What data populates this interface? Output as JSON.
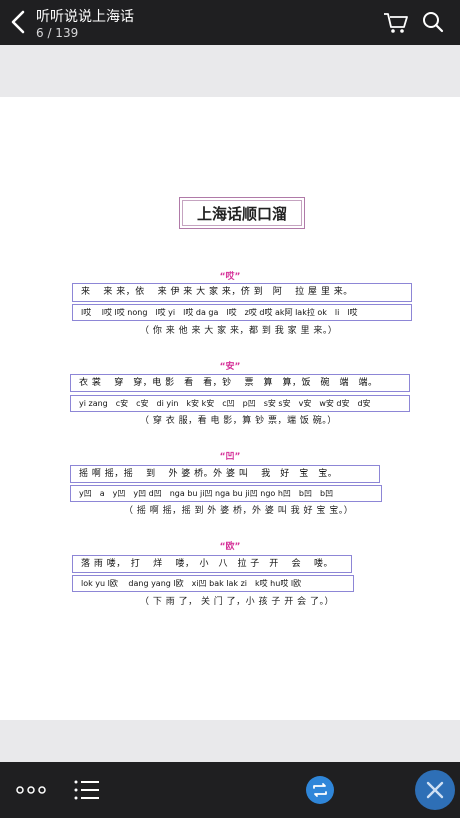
{
  "header": {
    "title": "听听说说上海话",
    "page_indicator": "6 / 139"
  },
  "document": {
    "title": "上海话顺口溜",
    "sections": [
      {
        "heading": "“哎”",
        "line": "来　 来 来，依　 来 伊 来 大 家 来，侪 到　阿　 拉 屋 里 来。",
        "pinyin": "l哎　 l哎 l哎 nong　l哎 yi　l哎 da ga　l哎　z哎 d哎 ak阿 lak拉 ok　li　l哎",
        "translation": "（ 你 来 他 来 大 家 来，都 到 我 家 里 来。）"
      },
      {
        "heading": "“安”",
        "line": "衣 裳　 穿　穿，电 影　看　看，钞　 票　算　算，饭　碗　端　端。",
        "pinyin": "yi zang　c安　c安　di yin　k安 k安　c凹　p凹　s安 s安　v安　w安 d安　d安",
        "translation": "（ 穿 衣 服，看 电 影，算 钞 票，端 饭 碗。）"
      },
      {
        "heading": "“凹”",
        "line": "摇 啊 摇，摇　 到　 外 婆 桥。外 婆 叫　 我　好　宝　宝。",
        "pinyin": "y凹　a　y凹　y凹 d凹　nga bu ji凹 nga bu ji凹 ngo h凹　b凹　b凹",
        "translation": "（ 摇 啊 摇，摇 到 外 婆 桥，外 婆 叫 我 好 宝 宝。）"
      },
      {
        "heading": "“欧”",
        "line": "落 雨 喽，　打　 烊　 喽，　小　八　拉 子　开　 会　 喽。",
        "pinyin": "lok yu l欧　 dang yang l欧　xi凹 bak lak zi　k哎 hu哎 l欧",
        "translation": "（ 下 雨 了， 关 门 了，小 孩 子 开 会 了。）"
      }
    ]
  },
  "icons": {
    "back": "back-chevron-icon",
    "cart": "cart-icon",
    "search": "search-icon",
    "more": "more-dots-icon",
    "list": "list-icon",
    "loop": "loop-icon",
    "close": "close-icon"
  },
  "colors": {
    "bar": "#1f1f21",
    "heading": "#d6339a",
    "box_border": "#8d86d6",
    "accent_blue": "#2f86d9"
  }
}
